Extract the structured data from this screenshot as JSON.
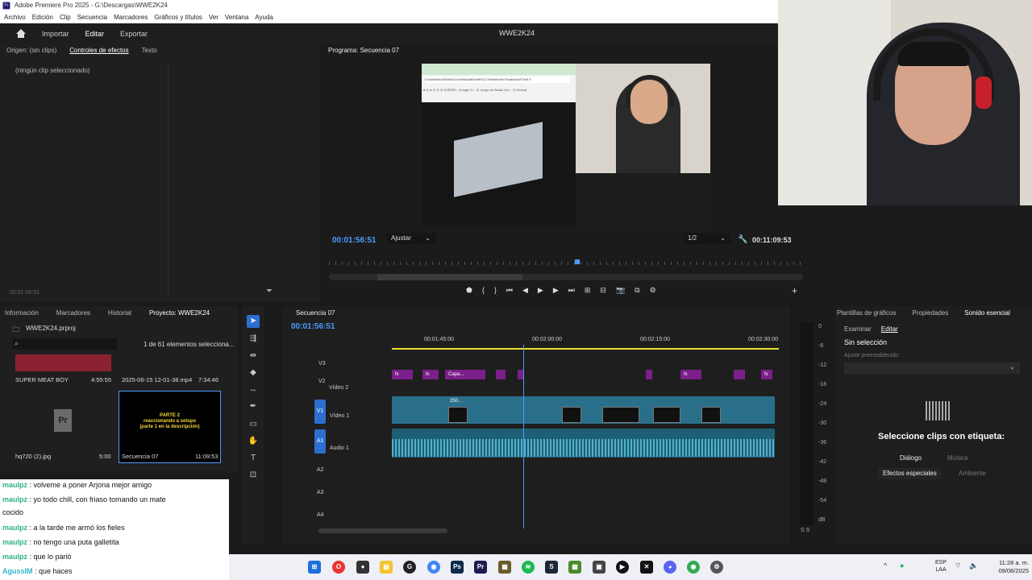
{
  "app": {
    "title": "Adobe Premiere Pro 2025 - G:\\Descargas\\WWE2K24",
    "logo": "Pr"
  },
  "menu": [
    "Archivo",
    "Edición",
    "Clip",
    "Secuencia",
    "Marcadores",
    "Gráficos y títulos",
    "Ver",
    "Ventana",
    "Ayuda"
  ],
  "workspace": {
    "tabs": [
      "Importar",
      "Editar",
      "Exportar"
    ],
    "active": "Editar",
    "project_name": "WWE2K24"
  },
  "left_panel": {
    "tabs": [
      "Origen: (sin clips)",
      "Controles de efectos",
      "Texto"
    ],
    "active_tab": "Controles de efectos",
    "no_clip": "(ningún clip seleccionado)",
    "timecode": "00:01:56:51"
  },
  "program": {
    "tab": "Programa: Secuencia 07",
    "timecode_current": "00:01:56:51",
    "fit": "Ajustar",
    "resolution": "1/2",
    "timecode_duration": "00:11:09:53",
    "browser_addr": "07fa9b6f8cd3555d0119cbf564a863a9f9121789f8d9c6e76dabab64f73e5 ©",
    "browser_bookmarks": "● ◎ ● ◎ ◎ ◎ DISEÑO - Google G... ◎ Juego de Bsdall Jun... ◎ Descar"
  },
  "project": {
    "tabs": [
      "Información",
      "Marcadores",
      "Historial",
      "Proyecto: WWE2K24"
    ],
    "active_tab": "Proyecto: WWE2K24",
    "file": "WWE2K24.prproj",
    "count": "1 de 61 elementos selecciona...",
    "items": [
      {
        "name": "SUPER MEAT BOY",
        "duration": "4:55:55"
      },
      {
        "name": "2025-06-15 12-01-38.mp4",
        "duration": "7:34:46"
      },
      {
        "name": "hq720 (2).jpg",
        "duration": "5:00"
      },
      {
        "name": "Secuencia 07",
        "duration": "11:09:53"
      }
    ],
    "seq_thumb_text": "PARTE 2\nreaccionando a setups\n(parte 1 en la descripción)"
  },
  "chat": [
    {
      "user": "maulpz",
      "text": " : volveme a poner Arjona mejor amigo"
    },
    {
      "user": "maulpz",
      "text": " : yo todo chill, con friaso tomando un mate"
    },
    {
      "user": "",
      "text": "cocido"
    },
    {
      "user": "maulpz",
      "text": " : a la tarde me armó los fieles"
    },
    {
      "user": "maulpz",
      "text": " : no tengo una puta galletita"
    },
    {
      "user": "maulpz",
      "text": " : que lo parió"
    },
    {
      "user": "AgussIM",
      "text": " : que haces"
    }
  ],
  "timeline": {
    "tab": "Secuencia 07",
    "timecode": "00:01:56:51",
    "marks": [
      "00:01:45:00",
      "00:02:00:00",
      "00:02:15:00",
      "00:02:30:00"
    ],
    "tracks": {
      "v3": "V3",
      "v2": "V2",
      "v2_name": "Vídeo 2",
      "v1": "V1",
      "v1_name": "Vídeo 1",
      "a1": "A1",
      "a1_name": "Audio 1",
      "a2": "A2",
      "a3": "A3",
      "a4": "A4"
    },
    "clip_labels": [
      "fx",
      "fx",
      "Capa...",
      "fx",
      "fx"
    ],
    "clip_250": "250..."
  },
  "meter": {
    "labels": [
      "0",
      "-6",
      "-12",
      "-18",
      "-24",
      "-30",
      "-36",
      "-42",
      "-48",
      "-54",
      "dB"
    ],
    "solo": "S S"
  },
  "essential": {
    "tabs": [
      "Plantillas de gráficos",
      "Propiedades",
      "Sonido esencial"
    ],
    "active_tab": "Sonido esencial",
    "subtabs": [
      "Examinar",
      "Editar"
    ],
    "active_subtab": "Editar",
    "no_selection": "Sin selección",
    "preset_label": "Ajuste preestablecido:",
    "message": "Seleccione clips con etiqueta:",
    "chips": [
      "Diálogo",
      "Música",
      "Efectos especiales",
      "Ambiente"
    ]
  },
  "taskbar": {
    "lang_top": "ESP",
    "lang_bottom": "LAA",
    "time": "11:28 a. m.",
    "date": "09/08/2025"
  }
}
